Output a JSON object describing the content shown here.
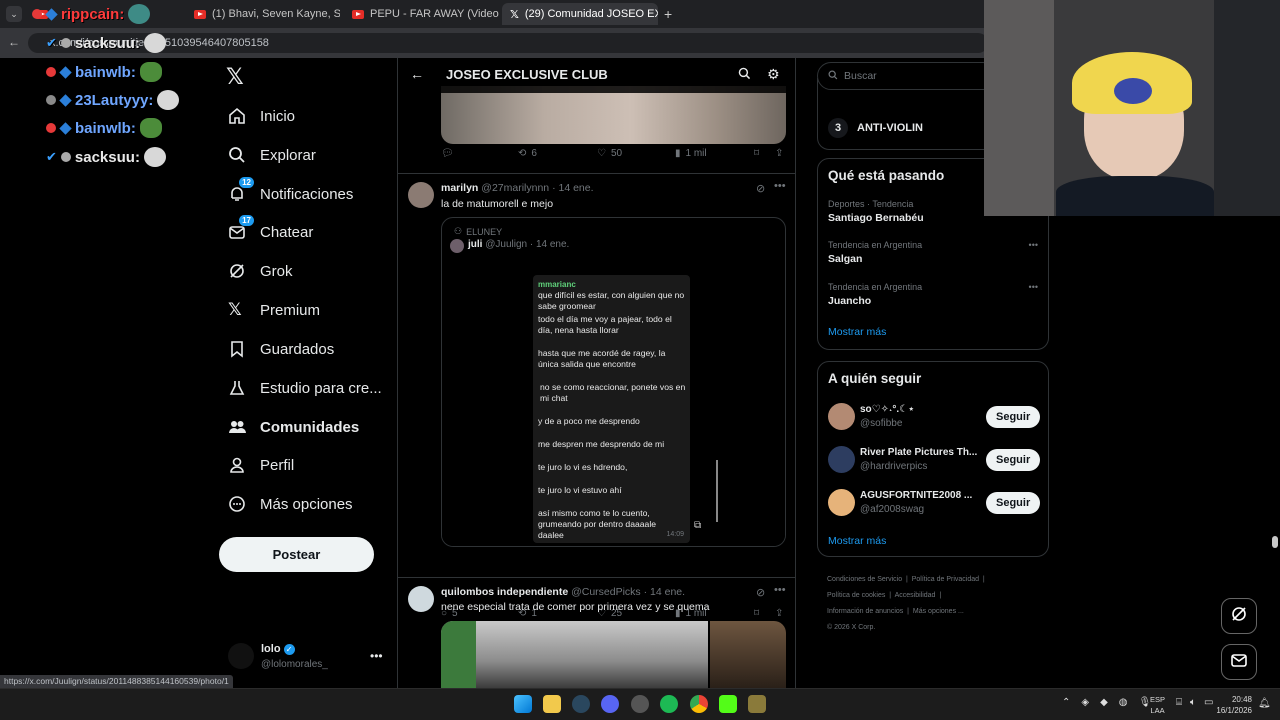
{
  "browser": {
    "tabs": [
      {
        "label": ""
      },
      {
        "label": "(1) Bhavi, Seven Kayne, Shako"
      },
      {
        "label": "PEPU - FAR AWAY (Video Oficia"
      },
      {
        "label": "(29) Comunidad JOSEO EXCLUS"
      }
    ],
    "url": "x.com/i/communities/1851039546407805158",
    "status_url": "https://x.com/Juulign/status/2011488385144160539/photo/1"
  },
  "chat": [
    {
      "user": "rippcain:",
      "color": "#ff3b3b"
    },
    {
      "user": "sacksuu:",
      "color": "#e8e8e8"
    },
    {
      "user": "bainwlb:",
      "color": "#6fa6ff"
    },
    {
      "user": "23Lautyyy:",
      "color": "#6fa6ff"
    },
    {
      "user": "bainwlb:",
      "color": "#6fa6ff"
    },
    {
      "user": "sacksuu:",
      "color": "#e8e8e8"
    }
  ],
  "nav": {
    "items": [
      {
        "label": "Inicio"
      },
      {
        "label": "Explorar"
      },
      {
        "label": "Notificaciones",
        "badge": "12"
      },
      {
        "label": "Chatear",
        "badge": "17"
      },
      {
        "label": "Grok"
      },
      {
        "label": "Premium"
      },
      {
        "label": "Guardados"
      },
      {
        "label": "Estudio para cre..."
      },
      {
        "label": "Comunidades"
      },
      {
        "label": "Perfil"
      },
      {
        "label": "Más opciones"
      }
    ],
    "post_label": "Postear",
    "account": {
      "name": "lolo",
      "handle": "@lolomorales_"
    }
  },
  "main": {
    "title": "JOSEO EXCLUSIVE CLUB",
    "post0": {
      "replies": "",
      "reposts": "6",
      "likes": "50",
      "views": "1 mil"
    },
    "post1": {
      "name": "marilyn",
      "handle": "@27marilynnn",
      "date": "· 14 ene.",
      "text": "la de matumorell e mejo",
      "quote": {
        "community": "ELUNEY",
        "name": "juli",
        "handle": "@Juulign",
        "date": "· 14 ene.",
        "chat_name": "mmarianc",
        "chat_lines": [
          "que difícil es estar, con alguien que no sabe groomear",
          "todo el día me voy a pajear, todo el día, nena hasta llorar",
          "hasta que me acordé de ragey, la única salida que encontre",
          "no se como reaccionar, ponete vos en mi chat",
          "y de a poco me desprendo",
          "me despren me desprendo de mi",
          "te juro lo vi es hdrendo,",
          "te juro lo vi estuvo ahí",
          "así mismo como te lo cuento, grumeando por dentro daaaale daalee"
        ],
        "chat_time": "14:09"
      },
      "replies": "5",
      "reposts": "1",
      "likes": "25",
      "views": "1 mil"
    },
    "post2": {
      "name": "quilombos independiente",
      "handle": "@CursedPicks",
      "date": "· 14 ene.",
      "text": "nene especial trata de comer por primera vez y se quema"
    }
  },
  "right": {
    "search_placeholder": "Buscar",
    "trending_top": {
      "rank": "3",
      "label": "ANTI-VIOLIN"
    },
    "happening": {
      "title": "Qué está pasando",
      "trends": [
        {
          "context": "Deportes · Tendencia",
          "name": "Santiago Bernabéu"
        },
        {
          "context": "Tendencia en Argentina",
          "name": "Salgan"
        },
        {
          "context": "Tendencia en Argentina",
          "name": "Juancho"
        }
      ],
      "more": "Mostrar más"
    },
    "follow": {
      "title": "A quién seguir",
      "users": [
        {
          "name": "so♡✧˖°.☾⋆",
          "handle": "@sofibbe"
        },
        {
          "name": "River Plate Pictures Th...",
          "handle": "@hardriverpics"
        },
        {
          "name": "AGUSFORTNITE2008 ...",
          "handle": "@af2008swag"
        }
      ],
      "button": "Seguir",
      "more": "Mostrar más"
    },
    "footer": [
      "Condiciones de Servicio",
      "Política de Privacidad",
      "Política de cookies",
      "Accesibilidad",
      "Información de anuncios",
      "Más opciones ...",
      "© 2026 X Corp."
    ]
  },
  "taskbar": {
    "lang1": "ESP",
    "lang2": "LAA",
    "time": "20:48",
    "date": "16/1/2026"
  }
}
